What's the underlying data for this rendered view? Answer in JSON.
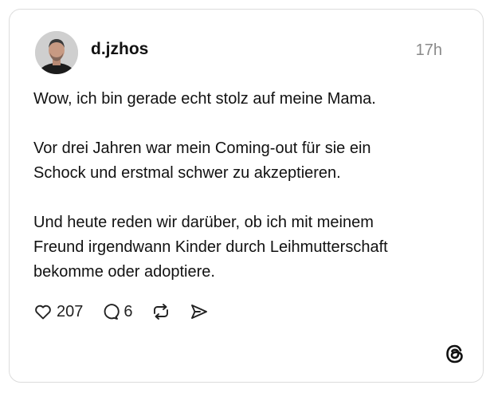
{
  "post": {
    "username": "d.jzhos",
    "timestamp": "17h",
    "paragraphs": [
      "Wow, ich bin gerade echt stolz auf meine Mama.",
      "Vor drei Jahren war mein Coming-out für sie ein\nSchock und erstmal schwer zu akzeptieren.",
      "Und heute reden wir darüber, ob ich mit meinem\nFreund irgendwann Kinder durch Leihmutterschaft\nbekomme oder adoptiere."
    ]
  },
  "actions": {
    "likes": "207",
    "replies": "6",
    "icons": {
      "like": "heart-icon",
      "reply": "comment-icon",
      "repost": "repost-icon",
      "share": "share-icon"
    }
  },
  "brand": {
    "logo": "threads-logo-icon"
  },
  "colors": {
    "text": "#111111",
    "muted": "#8a8a8a",
    "border": "#dcdcdc"
  }
}
